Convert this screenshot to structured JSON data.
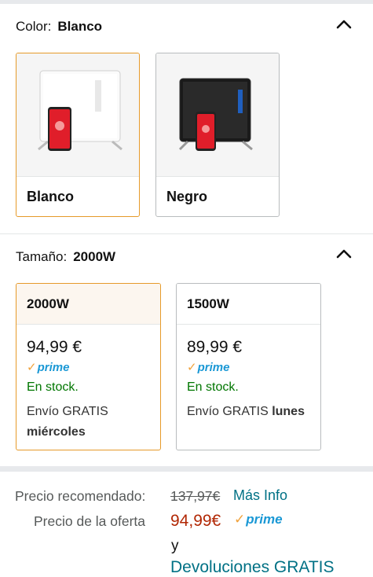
{
  "color_section": {
    "label": "Color:",
    "selected": "Blanco",
    "options": [
      {
        "label": "Blanco",
        "selected": true,
        "image": "white glass heater with phone"
      },
      {
        "label": "Negro",
        "selected": false,
        "image": "black glass heater with phone"
      }
    ]
  },
  "size_section": {
    "label": "Tamaño:",
    "selected": "2000W",
    "options": [
      {
        "label": "2000W",
        "price": "94,99 €",
        "prime": "prime",
        "stock": "En stock.",
        "shipping": "Envío GRATIS",
        "shipping_day": "miércoles",
        "selected": true
      },
      {
        "label": "1500W",
        "price": "89,99 €",
        "prime": "prime",
        "stock": "En stock.",
        "shipping": "Envío GRATIS",
        "shipping_day": "lunes",
        "selected": false
      }
    ]
  },
  "pricing": {
    "recommended_label": "Precio recomendado:",
    "recommended_price": "137,97€",
    "more_info": "Más Info",
    "offer_label": "Precio de la oferta",
    "offer_price": "94,99€",
    "prime": "prime",
    "and": "y",
    "returns": "Devoluciones GRATIS"
  },
  "colors": {
    "selected_border": "#e69a2a",
    "prime_blue": "#1a98d5",
    "prime_check": "#f0a23c",
    "in_stock": "#007600",
    "offer_price": "#b12704",
    "link": "#007185"
  }
}
